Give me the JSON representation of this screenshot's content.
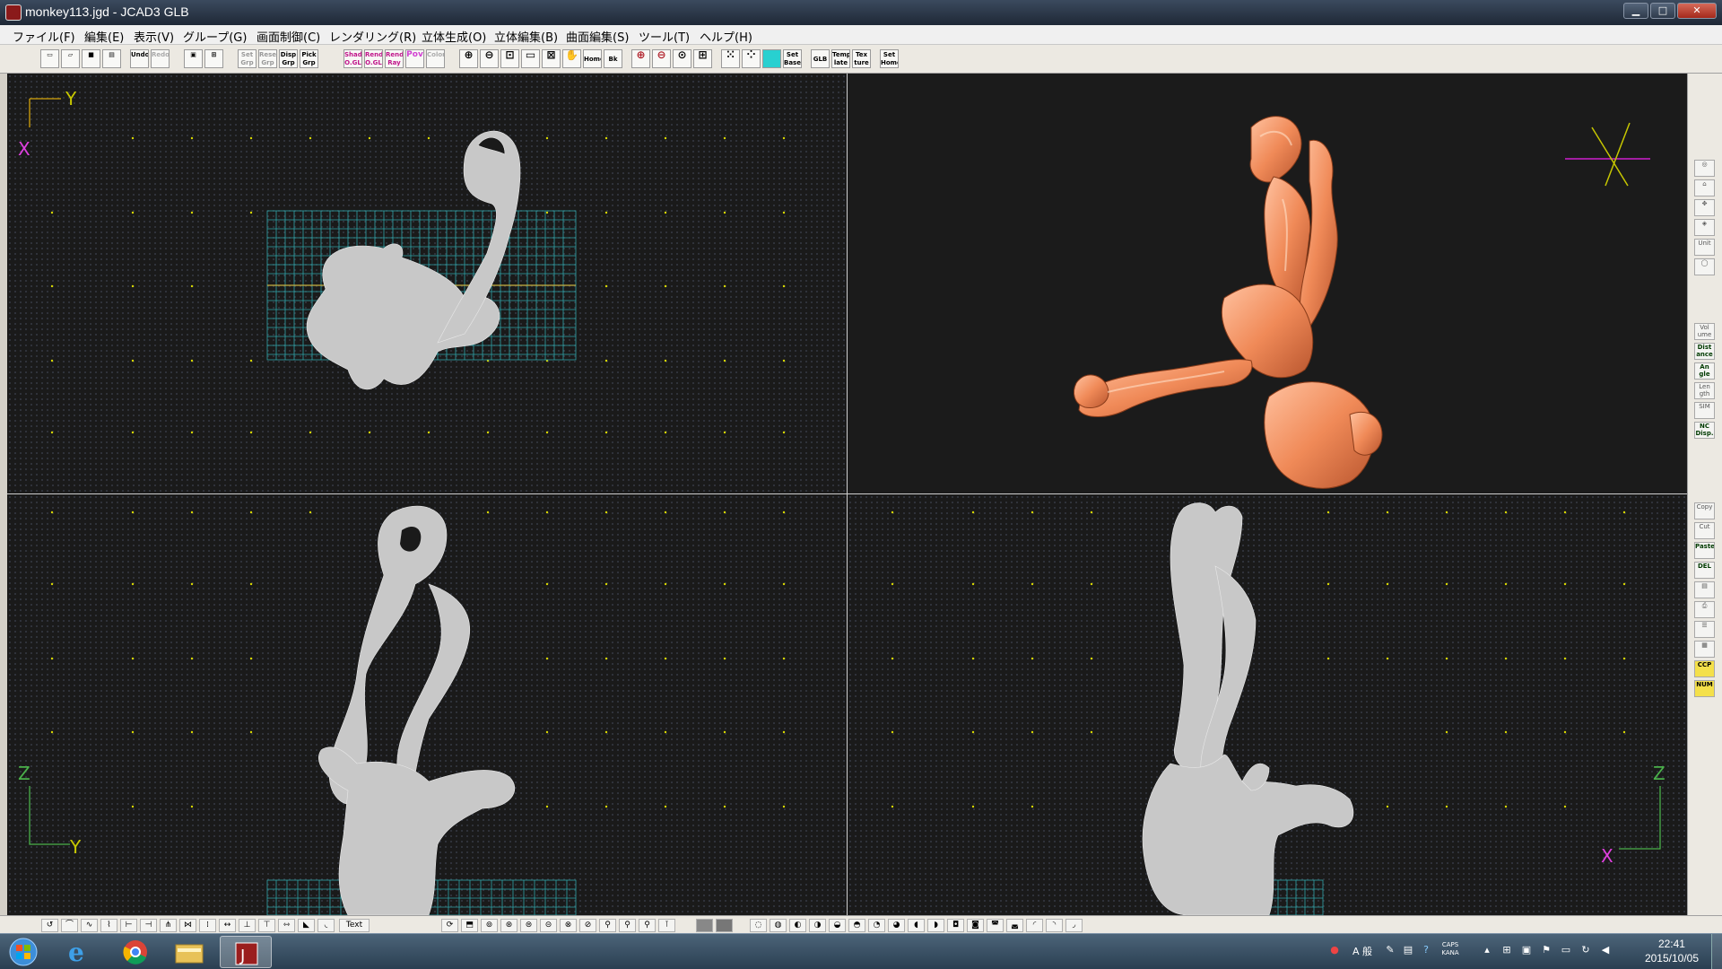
{
  "window": {
    "title": "monkey113.jgd - JCAD3 GLB"
  },
  "menu": [
    "ファイル(F)",
    "編集(E)",
    "表示(V)",
    "グループ(G)",
    "画面制御(C)",
    "レンダリング(R)",
    "立体生成(O)",
    "立体編集(B)",
    "曲面編集(S)",
    "ツール(T)",
    "ヘルプ(H)"
  ],
  "toolbar": {
    "groups": [
      [
        "new-icon",
        "open-icon",
        "save-icon",
        "print-icon"
      ],
      [
        "undo-icon",
        "redo-icon"
      ],
      [
        "window-icon",
        "layout-icon"
      ],
      [
        "set-grp",
        "reset-grp",
        "disp-grp",
        "pick-grp"
      ],
      [
        "shad-ogl",
        "rend-ogl",
        "rend-ray",
        "pov",
        "color"
      ],
      [
        "zoom-in-icon",
        "zoom-out-icon",
        "zoom-fit-icon",
        "zoom-window-icon",
        "zoom-box-icon",
        "pan-icon",
        "home",
        "bk",
        "zoom-obj-icon",
        "zoom-sel-icon",
        "zoom-all-icon",
        "zoom-fit2-icon"
      ],
      [
        "grid-icon",
        "grid-snap-icon",
        "grid-fill-icon",
        "set-base"
      ],
      [
        "glb",
        "template",
        "texture",
        "set-home"
      ]
    ],
    "labels": {
      "undo": "Undo",
      "redo": "Redo",
      "set_grp": "Set Grp",
      "reset_grp": "Reset Grp",
      "disp_grp": "Disp Grp",
      "pick_grp": "Pick Grp",
      "shad_ogl": "Shad O.GL",
      "rend_ogl": "Rend O.GL",
      "rend_ray": "Rend Ray",
      "pov": "Pov",
      "color": "Color",
      "home": "Home",
      "bk": "Bk",
      "set_base": "Set Base",
      "glb": "GLB",
      "template": "Temp late",
      "texture": "Tex ture",
      "set_home": "Set Home"
    }
  },
  "viewports": {
    "top": {
      "axis_h": "Y",
      "axis_v": "X"
    },
    "front": {
      "axis_h": "Y",
      "axis_v": "Z"
    },
    "side": {
      "axis_h": "X",
      "axis_v": "Z"
    }
  },
  "right_toolbar": {
    "buttons": [
      "Unit",
      "Vol ume",
      "Dist ance",
      "An gle",
      "Len gth",
      "SIM",
      "NC Disp.",
      "Copy",
      "Cut",
      "Paste",
      "DEL"
    ],
    "status": [
      "CCP",
      "NUM"
    ]
  },
  "bottom_toolbar": {
    "text_label": "Text"
  },
  "taskbar": {
    "apps": [
      "windows-start-icon",
      "ie-icon",
      "chrome-icon",
      "explorer-icon",
      "jcad-icon"
    ],
    "ime": "A 般",
    "caps": "CAPS KANA",
    "clock_time": "22:41",
    "clock_date": "2015/10/05"
  },
  "colors": {
    "viewport_bg": "#1a1a1a",
    "grid_dot": "#d8d800",
    "mesh_fill": "#c8c8c8",
    "render_orange": "#f0905c",
    "base_grid": "#2fa3a8"
  }
}
